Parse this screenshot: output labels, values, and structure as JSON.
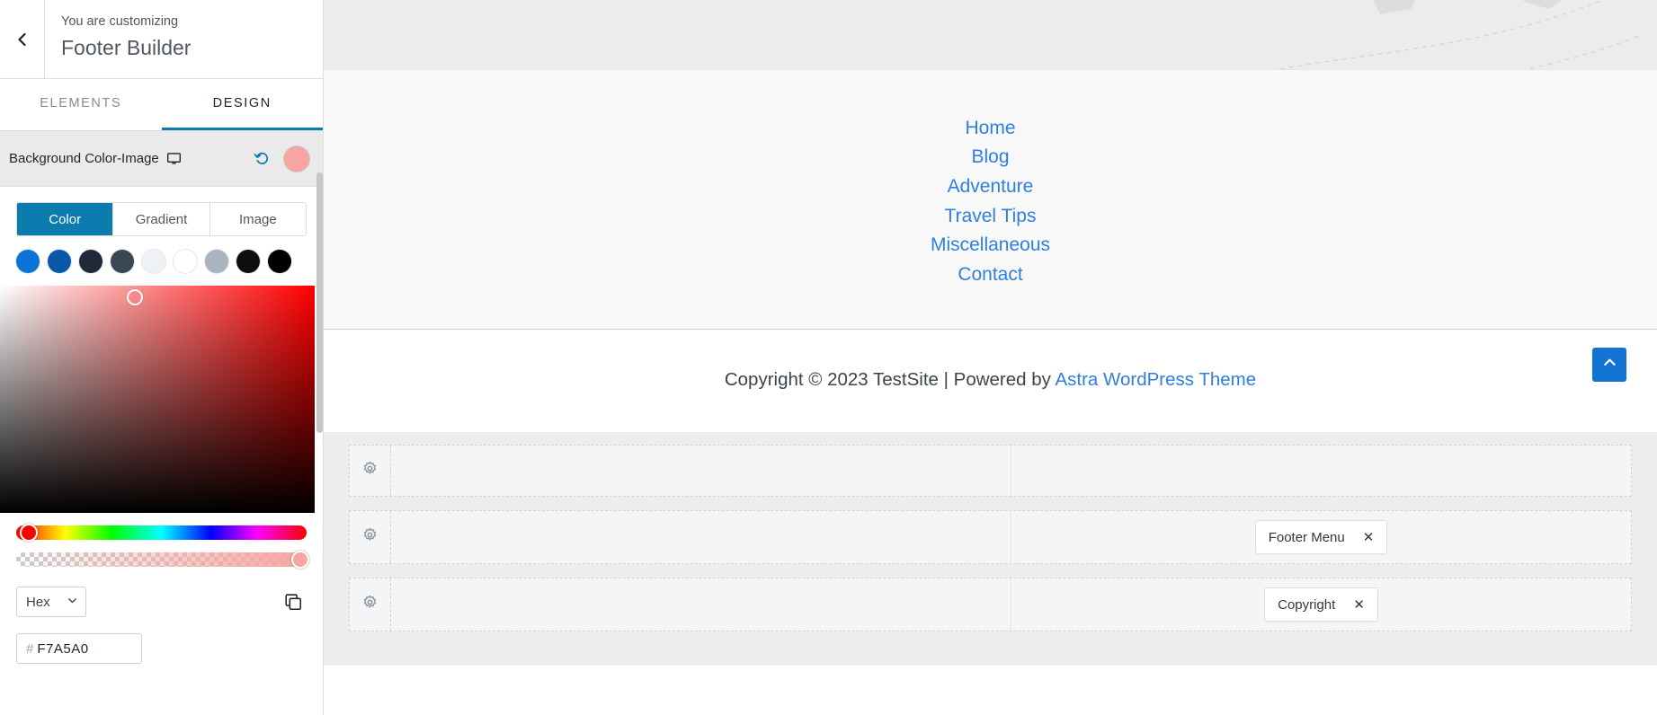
{
  "customizer": {
    "back_icon": "chevron-left-icon",
    "subtitle": "You are customizing",
    "title": "Footer Builder",
    "tabs": [
      {
        "label": "ELEMENTS",
        "active": false
      },
      {
        "label": "DESIGN",
        "active": true
      }
    ]
  },
  "control": {
    "label": "Background Color-Image",
    "device_icon": "monitor-icon",
    "reset_icon": "reset-icon",
    "swatch_color": "#f7a5a0"
  },
  "picker": {
    "tabs": [
      {
        "label": "Color",
        "active": true
      },
      {
        "label": "Gradient",
        "active": false
      },
      {
        "label": "Image",
        "active": false
      }
    ],
    "palette": [
      "#0a73d6",
      "#0857a8",
      "#1e2a3a",
      "#3a4654",
      "#eef2f6",
      "#ffffff",
      "#aab4bf",
      "#0e0e0e",
      "#000000"
    ],
    "selected_hue": "#ff0000",
    "format": "Hex",
    "format_chevron": "chevron-down-icon",
    "copy_icon": "copy-icon",
    "hex_hash": "#",
    "hex_value": "F7A5A0"
  },
  "preview": {
    "footer_menu": [
      "Home",
      "Blog",
      "Adventure",
      "Travel Tips",
      "Miscellaneous",
      "Contact"
    ],
    "copyright_prefix": "Copyright © 2023 TestSite | Powered by ",
    "copyright_link": "Astra WordPress Theme",
    "to_top_icon": "chevron-up-icon"
  },
  "builder": {
    "gear_icon": "gear-icon",
    "close_icon": "close-icon",
    "rows": [
      {
        "name": "above-footer-row",
        "chip": null
      },
      {
        "name": "primary-footer-row",
        "chip": "Footer Menu"
      },
      {
        "name": "below-footer-row",
        "chip": "Copyright"
      }
    ]
  }
}
